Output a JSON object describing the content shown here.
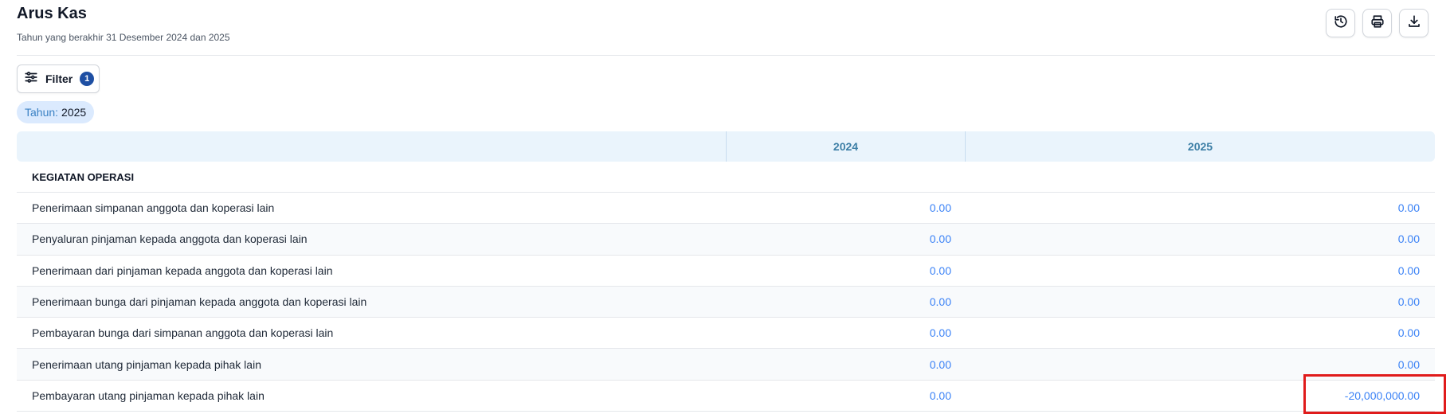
{
  "header": {
    "title": "Arus Kas",
    "subtitle": "Tahun yang berakhir 31 Desember 2024 dan 2025"
  },
  "actions": [
    {
      "icon": "history-icon"
    },
    {
      "icon": "printer-icon"
    },
    {
      "icon": "download-icon"
    }
  ],
  "filter": {
    "label": "Filter",
    "count": "1"
  },
  "chip": {
    "key": "Tahun:",
    "value": "2025"
  },
  "table": {
    "columns": [
      "2024",
      "2025"
    ],
    "section_title": "KEGIATAN OPERASI",
    "rows": [
      {
        "label": "Penerimaan simpanan anggota dan koperasi lain",
        "v2024": "0.00",
        "v2025": "0.00"
      },
      {
        "label": "Penyaluran pinjaman kepada anggota dan koperasi lain",
        "v2024": "0.00",
        "v2025": "0.00"
      },
      {
        "label": "Penerimaan dari pinjaman kepada anggota dan koperasi lain",
        "v2024": "0.00",
        "v2025": "0.00"
      },
      {
        "label": "Penerimaan bunga dari pinjaman kepada anggota dan koperasi lain",
        "v2024": "0.00",
        "v2025": "0.00"
      },
      {
        "label": "Pembayaran bunga dari simpanan anggota dan koperasi lain",
        "v2024": "0.00",
        "v2025": "0.00"
      },
      {
        "label": "Penerimaan utang pinjaman kepada pihak lain",
        "v2024": "0.00",
        "v2025": "0.00"
      },
      {
        "label": "Pembayaran utang pinjaman kepada pihak lain",
        "v2024": "0.00",
        "v2025": "-20,000,000.00"
      }
    ]
  },
  "colors": {
    "accent": "#3b82f6",
    "header_bg": "#eaf4fc",
    "badge": "#1e4fa3",
    "highlight": "#e01b1b"
  }
}
